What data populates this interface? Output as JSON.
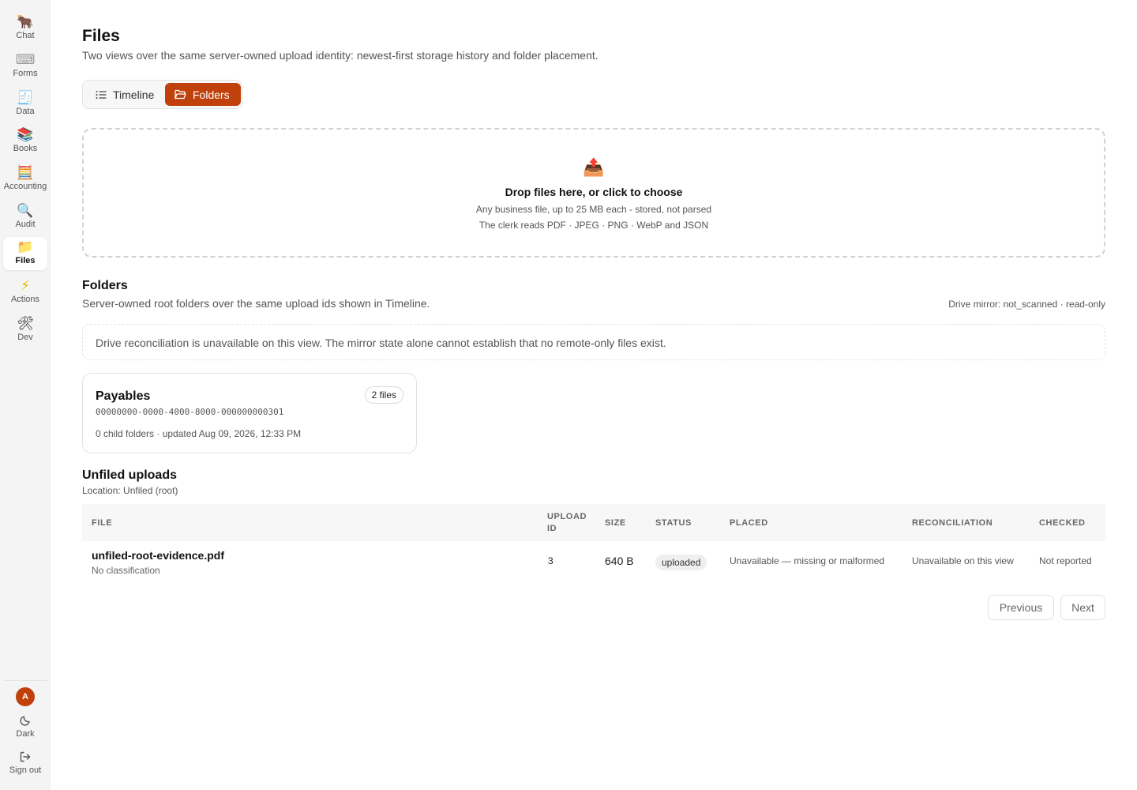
{
  "sidebar": {
    "items": [
      {
        "label": "Chat",
        "icon": "🐂"
      },
      {
        "label": "Forms",
        "icon": "⌨"
      },
      {
        "label": "Data",
        "icon": "🧾"
      },
      {
        "label": "Books",
        "icon": "📚"
      },
      {
        "label": "Accounting",
        "icon": "🧮"
      },
      {
        "label": "Audit",
        "icon": "🔍"
      },
      {
        "label": "Files",
        "icon": "📁"
      },
      {
        "label": "Actions",
        "icon": "⚡"
      },
      {
        "label": "Dev",
        "icon": "🛠"
      }
    ],
    "active": "Files",
    "avatar_initial": "A",
    "theme_label": "Dark",
    "signout_label": "Sign out"
  },
  "header": {
    "title": "Files",
    "subtitle": "Two views over the same server-owned upload identity: newest-first storage history and folder placement."
  },
  "view_toggle": {
    "timeline_label": "Timeline",
    "folders_label": "Folders",
    "selected": "Folders"
  },
  "dropzone": {
    "icon": "📤",
    "title": "Drop files here, or click to choose",
    "line1": "Any business file, up to 25 MB each - stored, not parsed",
    "line2": "The clerk reads PDF · JPEG · PNG · WebP and JSON"
  },
  "folders_section": {
    "title": "Folders",
    "subtitle": "Server-owned root folders over the same upload ids shown in Timeline.",
    "drive_mirror": "Drive mirror: not_scanned · read-only",
    "notice": "Drive reconciliation is unavailable on this view. The mirror state alone cannot establish that no remote-only files exist.",
    "folders": [
      {
        "name": "Payables",
        "badge": "2 files",
        "id": "00000000-0000-4000-8000-000000000301",
        "meta": "0 child folders · updated Aug 09, 2026, 12:33 PM"
      }
    ]
  },
  "unfiled": {
    "title": "Unfiled uploads",
    "location": "Location: Unfiled (root)",
    "columns": {
      "file": "FILE",
      "upload_id_1": "UPLOAD",
      "upload_id_2": "ID",
      "size": "SIZE",
      "status": "STATUS",
      "placed": "PLACED",
      "reconciliation": "RECONCILIATION",
      "checked": "CHECKED"
    },
    "rows": [
      {
        "file": "unfiled-root-evidence.pdf",
        "classification": "No classification",
        "upload_id": "3",
        "size": "640 B",
        "status": "uploaded",
        "placed": "Unavailable — missing or malformed",
        "reconciliation": "Unavailable on this view",
        "checked": "Not reported"
      }
    ]
  },
  "pagination": {
    "previous_label": "Previous",
    "next_label": "Next"
  },
  "colors": {
    "accent": "#c0410b",
    "sidebar_bg": "#f4f4f4"
  }
}
